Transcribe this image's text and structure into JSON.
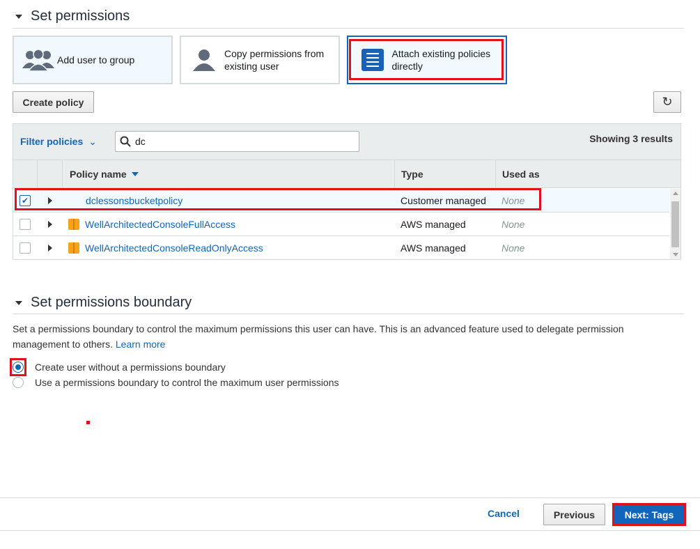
{
  "permissions": {
    "title": "Set permissions",
    "options": [
      {
        "label": "Add user to group"
      },
      {
        "label": "Copy permissions from existing user"
      },
      {
        "label": "Attach existing policies directly"
      }
    ],
    "create_policy_label": "Create policy",
    "refresh_icon": "↻"
  },
  "filter": {
    "label": "Filter policies",
    "chevron": "⌄",
    "search_value": "dc",
    "results_text": "Showing 3 results"
  },
  "table": {
    "headers": {
      "name": "Policy name",
      "type": "Type",
      "used_as": "Used as"
    },
    "rows": [
      {
        "name": "dclessonsbucketpolicy",
        "type": "Customer managed",
        "used_as": "None",
        "checked": true
      },
      {
        "name": "WellArchitectedConsoleFullAccess",
        "type": "AWS managed",
        "used_as": "None",
        "checked": false
      },
      {
        "name": "WellArchitectedConsoleReadOnlyAccess",
        "type": "AWS managed",
        "used_as": "None",
        "checked": false
      }
    ]
  },
  "boundary": {
    "title": "Set permissions boundary",
    "description": "Set a permissions boundary to control the maximum permissions this user can have. This is an advanced feature used to delegate permission management to others.",
    "learn_more": "Learn more",
    "radio_options": [
      {
        "label": "Create user without a permissions boundary",
        "checked": true
      },
      {
        "label": "Use a permissions boundary to control the maximum user permissions",
        "checked": false
      }
    ]
  },
  "footer": {
    "cancel_label": "Cancel",
    "previous_label": "Previous",
    "next_label": "Next: Tags"
  },
  "colors": {
    "accent": "#1166bb",
    "highlight": "#e0111b"
  }
}
